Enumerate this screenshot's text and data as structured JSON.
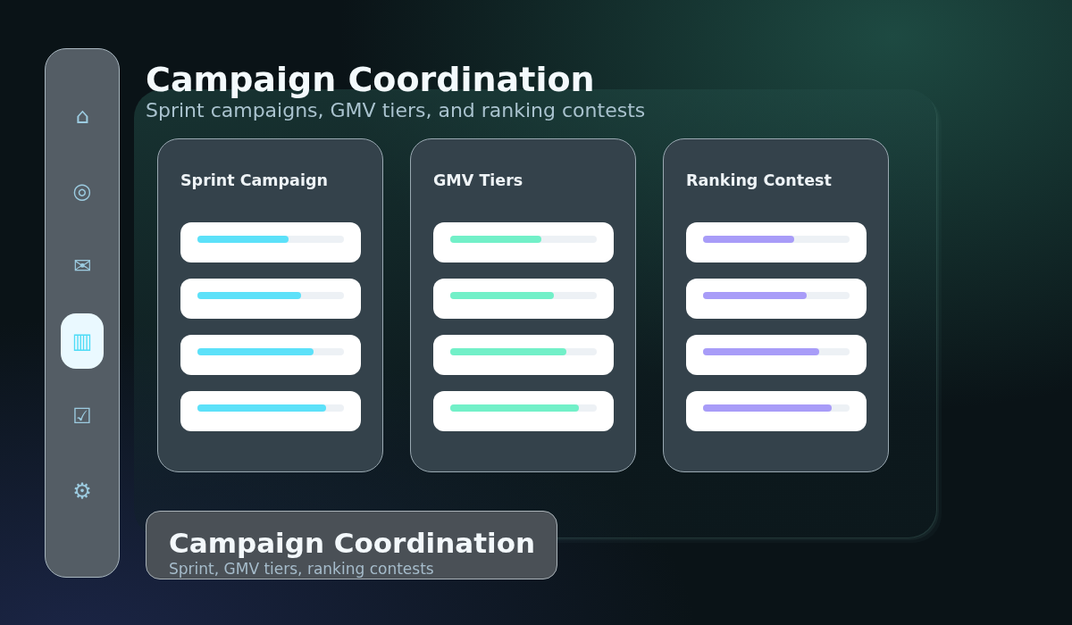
{
  "nav": [
    {
      "icon": "⌂",
      "selected": false
    },
    {
      "icon": "◎",
      "selected": false
    },
    {
      "icon": "✉",
      "selected": false
    },
    {
      "icon": "▥",
      "selected": true
    },
    {
      "icon": "☑",
      "selected": false
    },
    {
      "icon": "⚙",
      "selected": false
    }
  ],
  "header": {
    "title": "Campaign Coordination",
    "subtitle": "Sprint campaigns, GMV tiers, and ranking contests"
  },
  "cards": [
    {
      "title": "Sprint Campaign",
      "color": "#5ce1f9",
      "items": [
        {
          "level": 0.62
        },
        {
          "level": 0.71
        },
        {
          "level": 0.79
        },
        {
          "level": 0.88
        }
      ]
    },
    {
      "title": "GMV Tiers",
      "color": "#72f0c8",
      "items": [
        {
          "level": 0.62
        },
        {
          "level": 0.71
        },
        {
          "level": 0.79
        },
        {
          "level": 0.88
        }
      ]
    },
    {
      "title": "Ranking Contest",
      "color": "#a89cf8",
      "items": [
        {
          "level": 0.62
        },
        {
          "level": 0.71
        },
        {
          "level": 0.79
        },
        {
          "level": 0.88
        }
      ]
    }
  ],
  "footer_card": {
    "title": "Campaign Coordination",
    "subtitle": "Sprint, GMV tiers, ranking contests"
  }
}
